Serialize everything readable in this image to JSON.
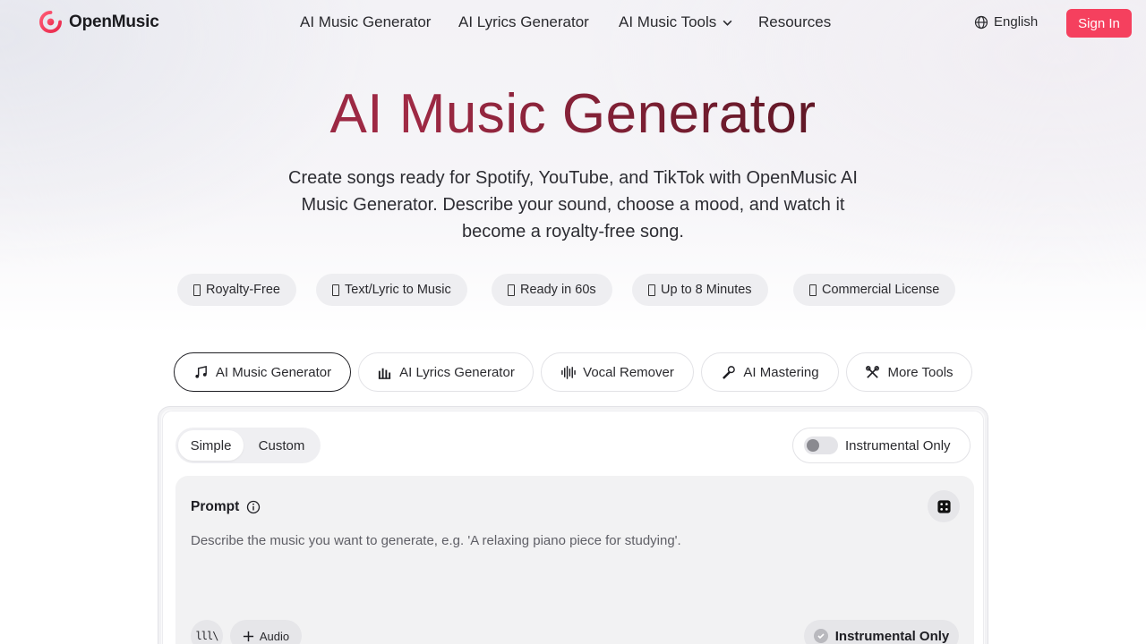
{
  "header": {
    "brand": "OpenMusic",
    "nav": [
      {
        "label": "AI Music Generator"
      },
      {
        "label": "AI Lyrics Generator"
      },
      {
        "label": "AI Music Tools"
      },
      {
        "label": "Resources"
      }
    ],
    "language": "English",
    "sign_in": "Sign In",
    "colors": {
      "brand": "#f5405e",
      "title_gradient": [
        "#7f1d37",
        "#2a0a12"
      ]
    }
  },
  "hero": {
    "title": "AI Music Generator",
    "subtitle": "Create songs ready for Spotify, YouTube, and TikTok with OpenMusic AI Music Generator. Describe your sound, choose a mood, and watch it become a royalty-free song."
  },
  "badges": [
    {
      "label": "Royalty-Free"
    },
    {
      "label": "Text/Lyric to Music"
    },
    {
      "label": "Ready in 60s"
    },
    {
      "label": "Up to 8 Minutes"
    },
    {
      "label": "Commercial License"
    }
  ],
  "tools": [
    {
      "label": "AI Music Generator",
      "icon": "music-notes-icon",
      "active": true
    },
    {
      "label": "AI Lyrics Generator",
      "icon": "lyrics-icon",
      "active": false
    },
    {
      "label": "Vocal Remover",
      "icon": "waveform-icon",
      "active": false
    },
    {
      "label": "AI Mastering",
      "icon": "microphone-icon",
      "active": false
    },
    {
      "label": "More Tools",
      "icon": "tools-icon",
      "active": false
    }
  ],
  "panel": {
    "modes": {
      "simple": "Simple",
      "custom": "Custom",
      "selected": "Simple"
    },
    "instrumental_toggle": {
      "label": "Instrumental Only",
      "on": false
    },
    "prompt": {
      "label": "Prompt",
      "placeholder": "Describe the music you want to generate, e.g. 'A relaxing piano piece for studying'.",
      "value": ""
    },
    "library_glyph": "lll\\",
    "audio_button": "Audio",
    "instrumental_chip": "Instrumental Only"
  }
}
